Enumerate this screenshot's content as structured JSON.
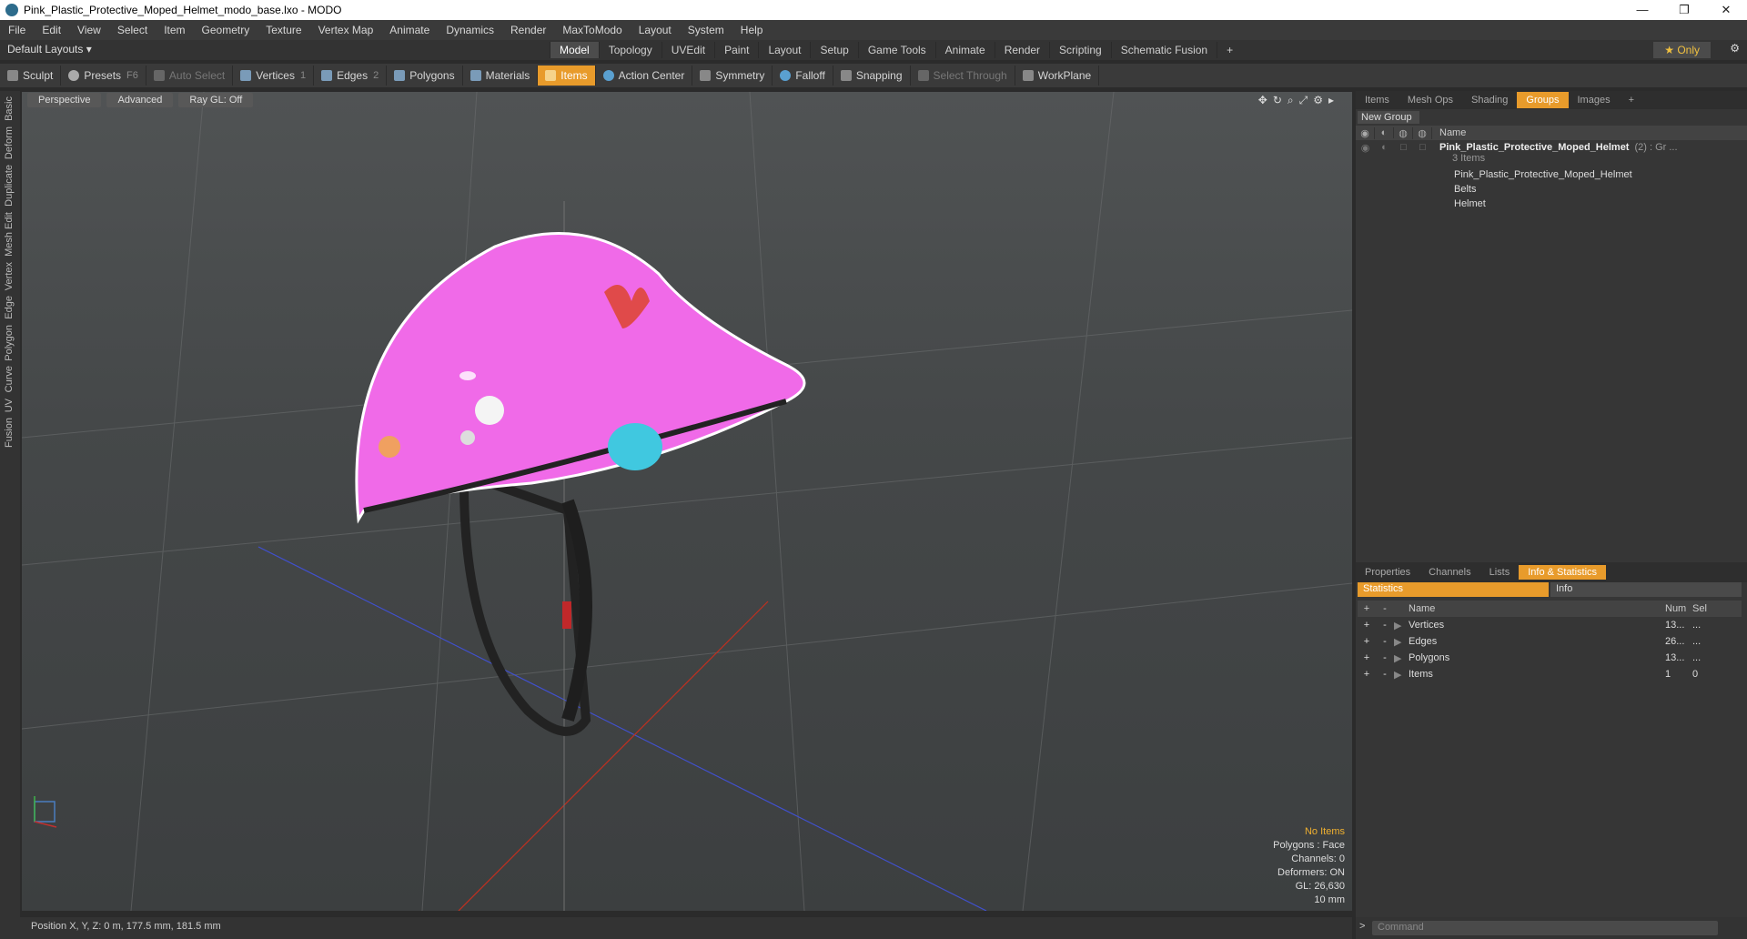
{
  "window": {
    "title": "Pink_Plastic_Protective_Moped_Helmet_modo_base.lxo - MODO"
  },
  "menu": [
    "File",
    "Edit",
    "View",
    "Select",
    "Item",
    "Geometry",
    "Texture",
    "Vertex Map",
    "Animate",
    "Dynamics",
    "Render",
    "MaxToModo",
    "Layout",
    "System",
    "Help"
  ],
  "layouts": "Default Layouts ▾",
  "tabs": [
    "Model",
    "Topology",
    "UVEdit",
    "Paint",
    "Layout",
    "Setup",
    "Game Tools",
    "Animate",
    "Render",
    "Scripting",
    "Schematic Fusion"
  ],
  "only_label": "★ Only",
  "toolbar": {
    "sculpt": "Sculpt",
    "presets": "Presets",
    "presets_sc": "F6",
    "auto_select": "Auto Select",
    "vertices": "Vertices",
    "vertices_n": "1",
    "edges": "Edges",
    "edges_n": "2",
    "polygons": "Polygons",
    "materials": "Materials",
    "items": "Items",
    "action_center": "Action Center",
    "symmetry": "Symmetry",
    "falloff": "Falloff",
    "snapping": "Snapping",
    "select_through": "Select Through",
    "workplane": "WorkPlane"
  },
  "left_tabs": [
    "Basic",
    "Deform",
    "Duplicate",
    "Mesh Edit",
    "Vertex",
    "Edge",
    "Polygon",
    "Curve",
    "UV",
    "Fusion"
  ],
  "viewport": {
    "perspective": "Perspective",
    "advanced": "Advanced",
    "raygl": "Ray GL: Off"
  },
  "viewport_info": {
    "no_items": "No Items",
    "polygons": "Polygons : Face",
    "channels": "Channels: 0",
    "deformers": "Deformers: ON",
    "gl": "GL: 26,630",
    "scale": "10 mm"
  },
  "status": "Position X, Y, Z:  0 m, 177.5 mm, 181.5 mm",
  "right_tabs": [
    "Items",
    "Mesh Ops",
    "Shading",
    "Groups",
    "Images"
  ],
  "new_group": "New Group",
  "groups_header": "Name",
  "group": {
    "name": "Pink_Plastic_Protective_Moped_Helmet",
    "suffix": "(2) : Gr ...",
    "count": "3 Items",
    "children": [
      "Pink_Plastic_Protective_Moped_Helmet",
      "Belts",
      "Helmet"
    ]
  },
  "bottom_tabs": [
    "Properties",
    "Channels",
    "Lists",
    "Info & Statistics"
  ],
  "stat_tabs": {
    "statistics": "Statistics",
    "info": "Info"
  },
  "stats_header": {
    "name": "Name",
    "num": "Num",
    "sel": "Sel"
  },
  "stats": [
    {
      "name": "Vertices",
      "num": "13...",
      "sel": "..."
    },
    {
      "name": "Edges",
      "num": "26...",
      "sel": "..."
    },
    {
      "name": "Polygons",
      "num": "13...",
      "sel": "..."
    },
    {
      "name": "Items",
      "num": "1",
      "sel": "0"
    }
  ],
  "command_placeholder": "Command"
}
